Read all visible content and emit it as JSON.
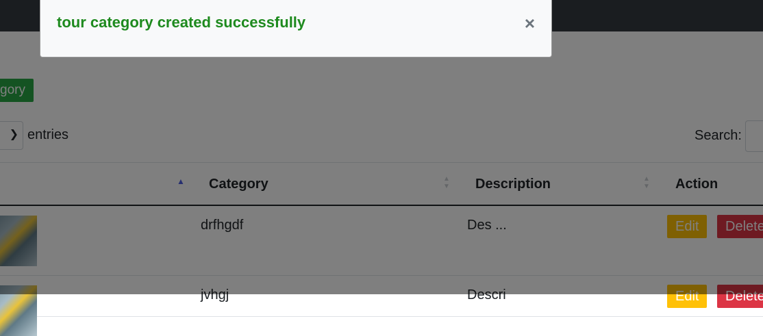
{
  "toolbar": {
    "add_label": "gory"
  },
  "length": {
    "entries_label": "entries",
    "chevron_icon": "chevron-down-icon"
  },
  "search": {
    "label": "Search:"
  },
  "table": {
    "columns": [
      "Category",
      "Description",
      "Action"
    ],
    "rows": [
      {
        "category": "drfhgdf",
        "description": "Des ...",
        "edit": "Edit",
        "delete": "Delete"
      },
      {
        "category": "jvhgj",
        "description": "Descri",
        "edit": "Edit",
        "delete": "Delete"
      }
    ]
  },
  "alert": {
    "message": "tour category created successfully",
    "close": "×"
  },
  "colors": {
    "topbar": "#343a40",
    "success": "#28a745",
    "edit": "#ffc107",
    "delete": "#dc3545",
    "alert_text": "#1e8a1e"
  }
}
